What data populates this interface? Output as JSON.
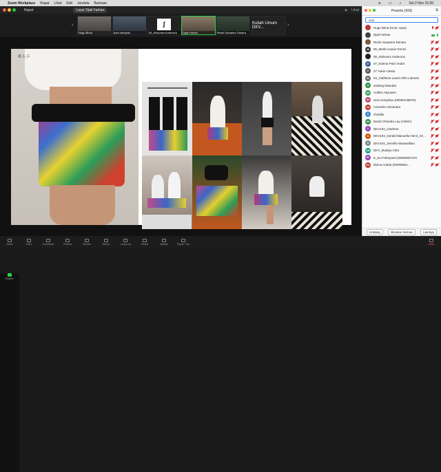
{
  "menubar": {
    "app": "Zoom Workplace",
    "items": [
      "Rapat",
      "Lihat",
      "Edit",
      "Jendela",
      "Bantuan"
    ],
    "clock": "Sel 2 Nov 15.50"
  },
  "window": {
    "title": "Rapat",
    "share_label": "Layar Djati Farhan",
    "view_label": "Lihat"
  },
  "strip": {
    "thumbs": [
      {
        "name": "Hugo Bima"
      },
      {
        "name": "azra vempido"
      },
      {
        "name": "06_Nickvans Anderson"
      },
      {
        "name": "Djati Farhan"
      },
      {
        "name": "Rezki Gautama Tamara"
      },
      {
        "name": "Kuliah Umum DKV..."
      }
    ],
    "text_tile": "azra vempido..."
  },
  "slide": {
    "mark": "@_L_C"
  },
  "participants": {
    "title": "Peserta (439)",
    "search_value": "Cari",
    "rows": [
      {
        "name": "Hugo Bima (Host, saya)",
        "avatar_color": "#b83a3a",
        "initials": "",
        "state": "host"
      },
      {
        "name": "Djati Farhan",
        "avatar_color": "#444444",
        "initials": "",
        "state": "cam-mic"
      },
      {
        "name": "Rezki Gautama Tamara",
        "avatar_color": "#7a5a40",
        "initials": "",
        "state": "muted"
      },
      {
        "name": "06_Merlin Ivania Tommi",
        "avatar_color": "#333333",
        "initials": "06",
        "state": "muted"
      },
      {
        "name": "06_Nickvans Anderson",
        "avatar_color": "#222222",
        "initials": "",
        "state": "muted"
      },
      {
        "name": "07_Estena Putri Andra",
        "avatar_color": "#3b5998",
        "initials": "07",
        "state": "muted"
      },
      {
        "name": "27 Yukie Clesta",
        "avatar_color": "#555555",
        "initials": "27",
        "state": "muted"
      },
      {
        "name": "04_Cathlene Liand Arifin Lukman",
        "avatar_color": "#6b6b6b",
        "initials": "04",
        "state": "muted"
      },
      {
        "name": "andang iskandar",
        "avatar_color": "#2f8f46",
        "initials": "AI",
        "state": "muted"
      },
      {
        "name": "Ardiles Akyuwen",
        "avatar_color": "#3aa655",
        "initials": "AA",
        "state": "muted"
      },
      {
        "name": "azra vempidou (00000135979)",
        "avatar_color": "#b8467a",
        "initials": "AV",
        "state": "muted"
      },
      {
        "name": "Carmelin Alexandra",
        "avatar_color": "#c0392b",
        "initials": "CA",
        "state": "muted"
      },
      {
        "name": "chrisilla",
        "avatar_color": "#3e8ed0",
        "initials": "C",
        "state": "muted"
      },
      {
        "name": "David Chandra Ley (ASMA)",
        "avatar_color": "#2f8f46",
        "initials": "DC",
        "state": "muted"
      },
      {
        "name": "DKV104_charlene",
        "avatar_color": "#8e44ad",
        "initials": "D",
        "state": "muted"
      },
      {
        "name": "DKV104_Gerald Manuella Henri_Kri...",
        "avatar_color": "#d35400",
        "initials": "D",
        "state": "muted"
      },
      {
        "name": "DKV104_Jennifer Maxwelliam",
        "avatar_color": "#7f8c8d",
        "initials": "D",
        "state": "muted"
      },
      {
        "name": "DKV_Mudiya Citra",
        "avatar_color": "#16a085",
        "initials": "DM",
        "state": "muted"
      },
      {
        "name": "E_Evi Febriyanti (00000067370",
        "avatar_color": "#8e44ad",
        "initials": "EF",
        "state": "muted"
      },
      {
        "name": "Elvina Aralda (00000064...",
        "avatar_color": "#c0392b",
        "initials": "EA",
        "state": "muted"
      }
    ],
    "footer": {
      "invite": "Undang",
      "mute_all": "Bisukan Semua",
      "more": "Lainnya"
    }
  },
  "toolbar": {
    "items": [
      "Audio",
      "Video",
      "Keamanan",
      "Peserta",
      "Obrolan",
      "Bagikan",
      "Rekam",
      "Langsung",
      "Reaksi",
      "Aplikasi",
      "Papan Tulis",
      "Akhiri"
    ]
  }
}
